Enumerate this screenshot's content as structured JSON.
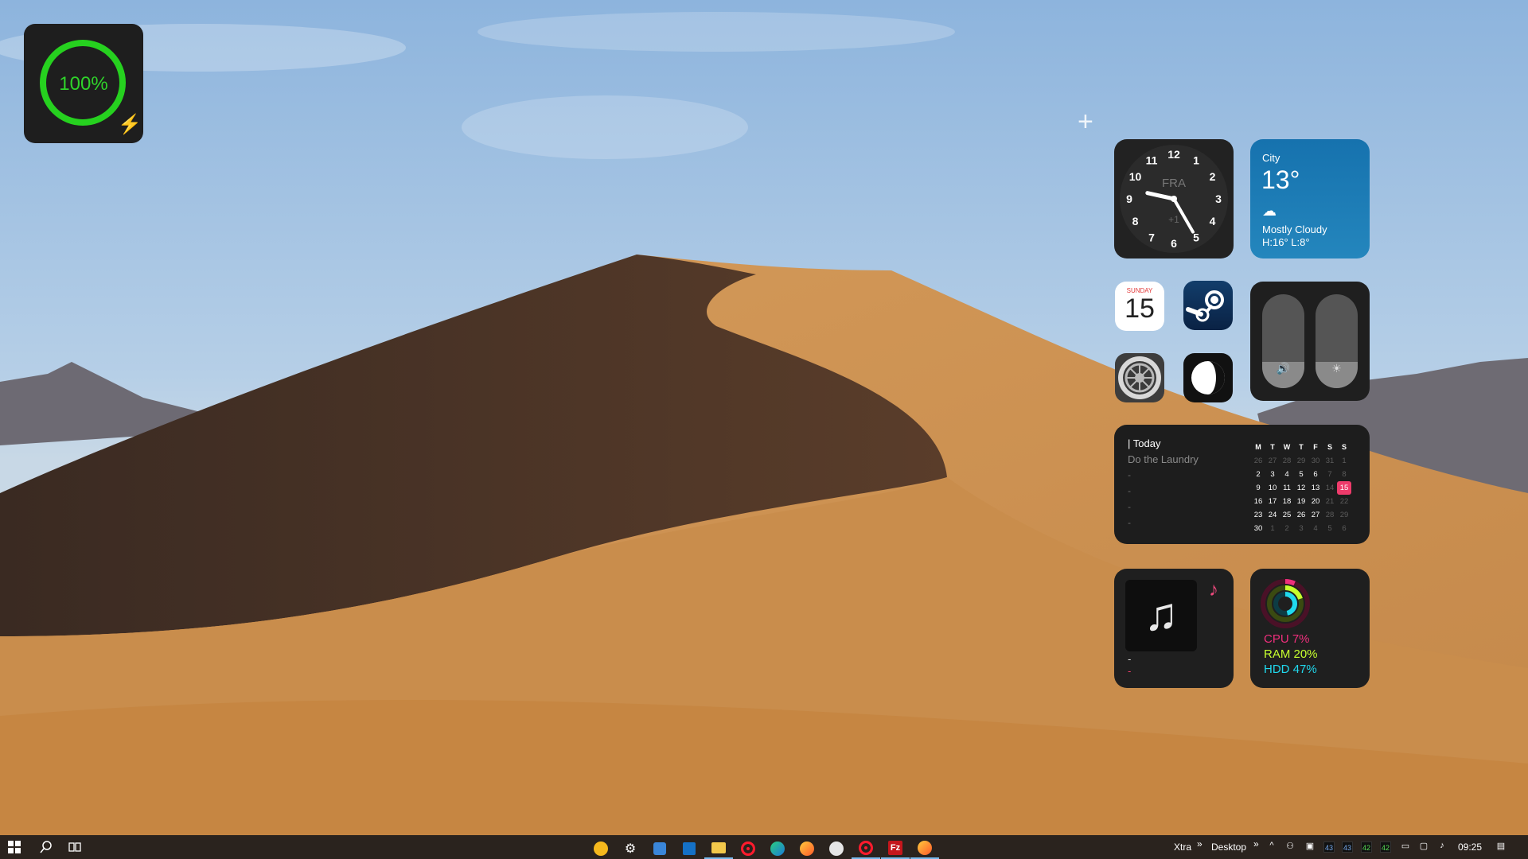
{
  "battery": {
    "percent_label": "100%",
    "charging_icon": "bolt-icon",
    "accent": "#26d11f"
  },
  "add_widget": {
    "label": "+"
  },
  "clock": {
    "city": "FRA",
    "offset": "+1",
    "numbers": [
      "12",
      "1",
      "2",
      "3",
      "4",
      "5",
      "6",
      "7",
      "8",
      "9",
      "10",
      "11"
    ],
    "time": "09:25"
  },
  "weather": {
    "city": "City",
    "temperature": "13°",
    "condition": "Mostly Cloudy",
    "high_low": "H:16° L:8°",
    "icon": "cloud-icon"
  },
  "apps": {
    "calendar": {
      "weekday": "SUNDAY",
      "date": "15"
    },
    "steam": {
      "icon": "steam-icon"
    },
    "settings": {
      "icon": "gear-icon"
    },
    "disk": {
      "icon": "disk-icon"
    }
  },
  "controls": {
    "volume_icon": "🔊",
    "brightness_icon": "☀",
    "volume_level": 0.28,
    "brightness_level": 0.28
  },
  "todo": {
    "header": "| Today",
    "task": "Do the Laundry",
    "placeholders": [
      "-",
      "-",
      "-",
      "-"
    ],
    "calendar": {
      "weekdays": [
        "M",
        "T",
        "W",
        "T",
        "F",
        "S",
        "S"
      ],
      "weeks": [
        [
          "26",
          "27",
          "28",
          "29",
          "30",
          "31",
          "1"
        ],
        [
          "2",
          "3",
          "4",
          "5",
          "6",
          "7",
          "8"
        ],
        [
          "9",
          "10",
          "11",
          "12",
          "13",
          "14",
          "15"
        ],
        [
          "16",
          "17",
          "18",
          "19",
          "20",
          "21",
          "22"
        ],
        [
          "23",
          "24",
          "25",
          "26",
          "27",
          "28",
          "29"
        ],
        [
          "30",
          "1",
          "2",
          "3",
          "4",
          "5",
          "6"
        ]
      ],
      "today": "15"
    }
  },
  "music": {
    "title": "-",
    "artist": "-",
    "icon": "music-note-icon"
  },
  "system": {
    "cpu": "CPU 7%",
    "ram": "RAM 20%",
    "hdd": "HDD 47%"
  },
  "taskbar": {
    "tray_labels": {
      "xtra": "Xtra",
      "desktop": "Desktop",
      "chevron": "»"
    },
    "tray_badges": [
      "43",
      "43",
      "42",
      "42"
    ],
    "time": "09:25"
  }
}
